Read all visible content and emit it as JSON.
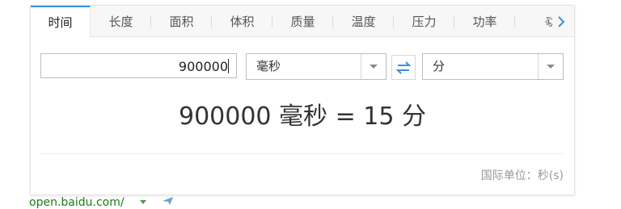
{
  "tabs": [
    {
      "label": "时间",
      "active": true
    },
    {
      "label": "长度",
      "active": false
    },
    {
      "label": "面积",
      "active": false
    },
    {
      "label": "体积",
      "active": false
    },
    {
      "label": "质量",
      "active": false
    },
    {
      "label": "温度",
      "active": false
    },
    {
      "label": "压力",
      "active": false
    },
    {
      "label": "功率",
      "active": false
    }
  ],
  "tab_partial": "功",
  "converter": {
    "input_value": "900000",
    "from_unit": "毫秒",
    "to_unit": "分"
  },
  "result": "900000 毫秒 = 15 分",
  "standard_unit": "国际单位：秒(s)",
  "source_url": "open.baidu.com/",
  "colors": {
    "accent": "#3a8fdc",
    "url_green": "#1a7d1a",
    "muted": "#9a9a9a"
  },
  "icons": [
    "chevron-left-icon",
    "chevron-right-icon",
    "chevron-down-icon",
    "swap-icon",
    "share-icon"
  ]
}
